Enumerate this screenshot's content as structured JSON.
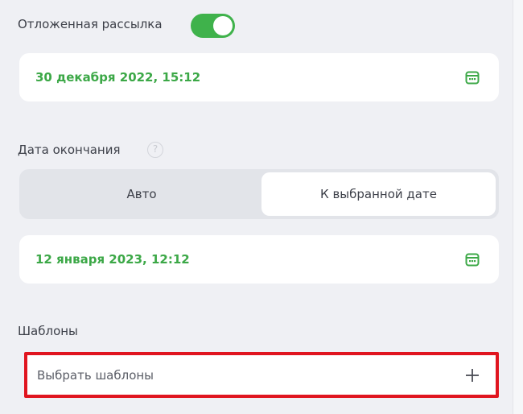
{
  "deferred_send": {
    "label": "Отложенная рассылка",
    "enabled": true,
    "start_date": "30 декабря 2022, 15:12"
  },
  "end_date": {
    "label": "Дата окончания",
    "help_icon": "help-circle-icon",
    "options": [
      "Авто",
      "К выбранной дате"
    ],
    "selected": "К выбранной дате",
    "value": "12 января 2023, 12:12"
  },
  "templates": {
    "label": "Шаблоны",
    "placeholder": "Выбрать шаблоны",
    "add_icon": "plus-icon"
  },
  "colors": {
    "accent_green": "#3fb24b",
    "highlight_red": "#e0151f"
  }
}
